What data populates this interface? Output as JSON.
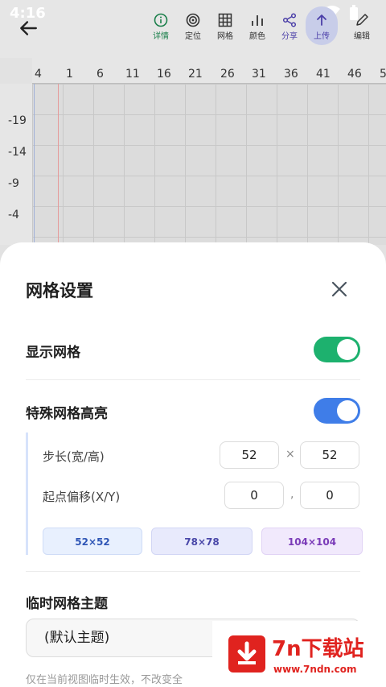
{
  "status_bar": {
    "time": "4:16"
  },
  "toolbar": {
    "items": [
      {
        "label": "详情",
        "icon": "info-icon"
      },
      {
        "label": "定位",
        "icon": "target-icon"
      },
      {
        "label": "网格",
        "icon": "grid-icon"
      },
      {
        "label": "颜色",
        "icon": "bar-chart-icon"
      },
      {
        "label": "分享",
        "icon": "share-icon"
      },
      {
        "label": "上传",
        "icon": "upload-icon"
      },
      {
        "label": "编辑",
        "icon": "pencil-icon"
      }
    ]
  },
  "ruler": {
    "top": [
      "4",
      "1",
      "6",
      "11",
      "16",
      "21",
      "26",
      "31",
      "36",
      "41",
      "46",
      "5"
    ],
    "left": [
      "-19",
      "-14",
      "-9",
      "-4"
    ]
  },
  "sheet": {
    "title": "网格设置",
    "show_grid": {
      "label": "显示网格",
      "on": true
    },
    "special_highlight": {
      "label": "特殊网格高亮",
      "on": true
    },
    "step": {
      "label": "步长(宽/高)",
      "width": "52",
      "height": "52",
      "sep": "×"
    },
    "offset": {
      "label": "起点偏移(X/Y)",
      "x": "0",
      "y": "0",
      "sep": ","
    },
    "presets": [
      "52×52",
      "78×78",
      "104×104"
    ],
    "theme": {
      "label": "临时网格主题",
      "value": "(默认主题)"
    },
    "hint": "仅在当前视图临时生效，不改变全"
  },
  "watermark": {
    "text": "7n下载站",
    "url": "www.7ndn.com"
  },
  "colors": {
    "toggle_green": "#1db16e",
    "toggle_blue": "#3f7de8",
    "accent_red": "#e0231f"
  }
}
